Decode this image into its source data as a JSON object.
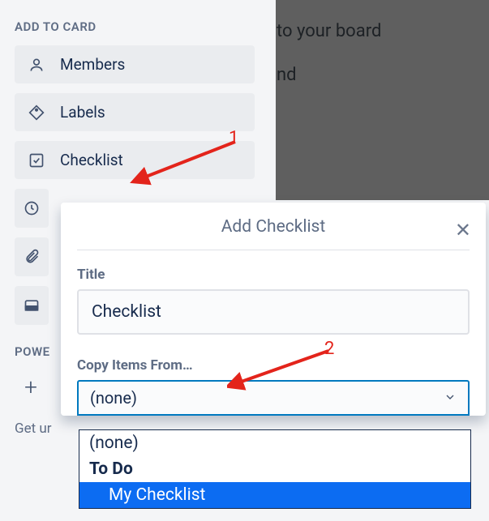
{
  "background": {
    "text1": "to your board",
    "text2": "nd"
  },
  "sidebar": {
    "section_title": "ADD TO CARD",
    "items": [
      {
        "label": "Members",
        "icon": "person-icon"
      },
      {
        "label": "Labels",
        "icon": "tag-icon"
      },
      {
        "label": "Checklist",
        "icon": "checkbox-icon"
      }
    ],
    "hidden_items": [
      {
        "icon": "clock-icon"
      },
      {
        "icon": "attachment-icon"
      },
      {
        "icon": "card-icon"
      }
    ],
    "power_title": "POWE",
    "get_text": "Get ur"
  },
  "popover": {
    "title": "Add Checklist",
    "title_label": "Title",
    "title_value": "Checklist",
    "copy_label": "Copy Items From…",
    "select_value": "(none)"
  },
  "dropdown": {
    "options": [
      {
        "label": "(none)",
        "bold": false,
        "selected": false
      },
      {
        "label": "To Do",
        "bold": true,
        "selected": false
      },
      {
        "label": "My Checklist",
        "bold": false,
        "selected": true
      }
    ]
  },
  "annotations": {
    "label1": "1",
    "label2": "2"
  }
}
